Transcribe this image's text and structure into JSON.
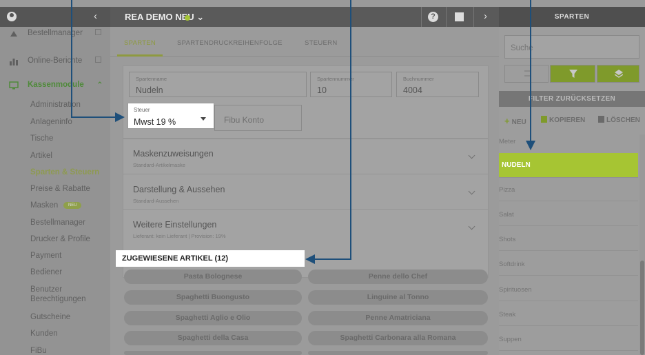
{
  "topbar": {
    "title": "REA DEMO NEU ⌄",
    "right_title": "SPARTEN"
  },
  "sidebar": {
    "items": [
      {
        "label": "Bestellmanager"
      },
      {
        "label": "Online-Berichte"
      },
      {
        "label": "Kassenmodule"
      }
    ],
    "sub_items": [
      {
        "label": "Administration"
      },
      {
        "label": "Anlageninfo"
      },
      {
        "label": "Tische"
      },
      {
        "label": "Artikel"
      },
      {
        "label": "Sparten & Steuern"
      },
      {
        "label": "Preise & Rabatte"
      },
      {
        "label": "Masken"
      },
      {
        "label": "Bestellmanager"
      },
      {
        "label": "Drucker & Profile"
      },
      {
        "label": "Payment"
      },
      {
        "label": "Bediener"
      },
      {
        "label": "Benutzer Berechtigungen"
      },
      {
        "label": "Gutscheine"
      },
      {
        "label": "Kunden"
      },
      {
        "label": "FiBu"
      }
    ],
    "badge": "NEU"
  },
  "tabs": [
    "SPARTEN",
    "SPARTENDRUCKREIHENFOLGE",
    "STEUERN"
  ],
  "form": {
    "spartenname_label": "Spartenname",
    "spartenname_value": "Nudeln",
    "spartennummer_label": "Spartennummer",
    "spartennummer_value": "10",
    "buchnummer_label": "Buchnummer",
    "buchnummer_value": "4004",
    "steuer_label": "Steuer",
    "steuer_value": "Mwst 19 %",
    "fibu_placeholder": "Fibu Konto"
  },
  "accordions": [
    {
      "title": "Maskenzuweisungen",
      "subtitle": "Standard-Artikelmaske"
    },
    {
      "title": "Darstellung & Aussehen",
      "subtitle": "Standard-Aussehen"
    },
    {
      "title": "Weitere Einstellungen",
      "subtitle": "Lieferant: kein Lieferant | Provision: 19%"
    }
  ],
  "assigned": {
    "title": "ZUGEWIESENE ARTIKEL (12)",
    "items": [
      "Pasta Bolognese",
      "Penne dello Chef",
      "Spaghetti Buongusto",
      "Linguine al Tonno",
      "Spaghetti Aglio e Olio",
      "Penne Amatriciana",
      "Spaghetti della Casa",
      "Spaghetti Carbonara alla Romana"
    ]
  },
  "right": {
    "search_placeholder": "Suche",
    "filter_reset": "FILTER ZURÜCKSETZEN",
    "new_label": "NEU",
    "copy_label": "KOPIEREN",
    "delete_label": "LÖSCHEN",
    "list": [
      "Meter",
      "NUDELN",
      "Pizza",
      "Salat",
      "Shots",
      "Softdrink",
      "Spirituosen",
      "Steak",
      "Suppen"
    ]
  },
  "colors": {
    "accent": "#a6c533",
    "annotation": "#1e4f7a"
  }
}
